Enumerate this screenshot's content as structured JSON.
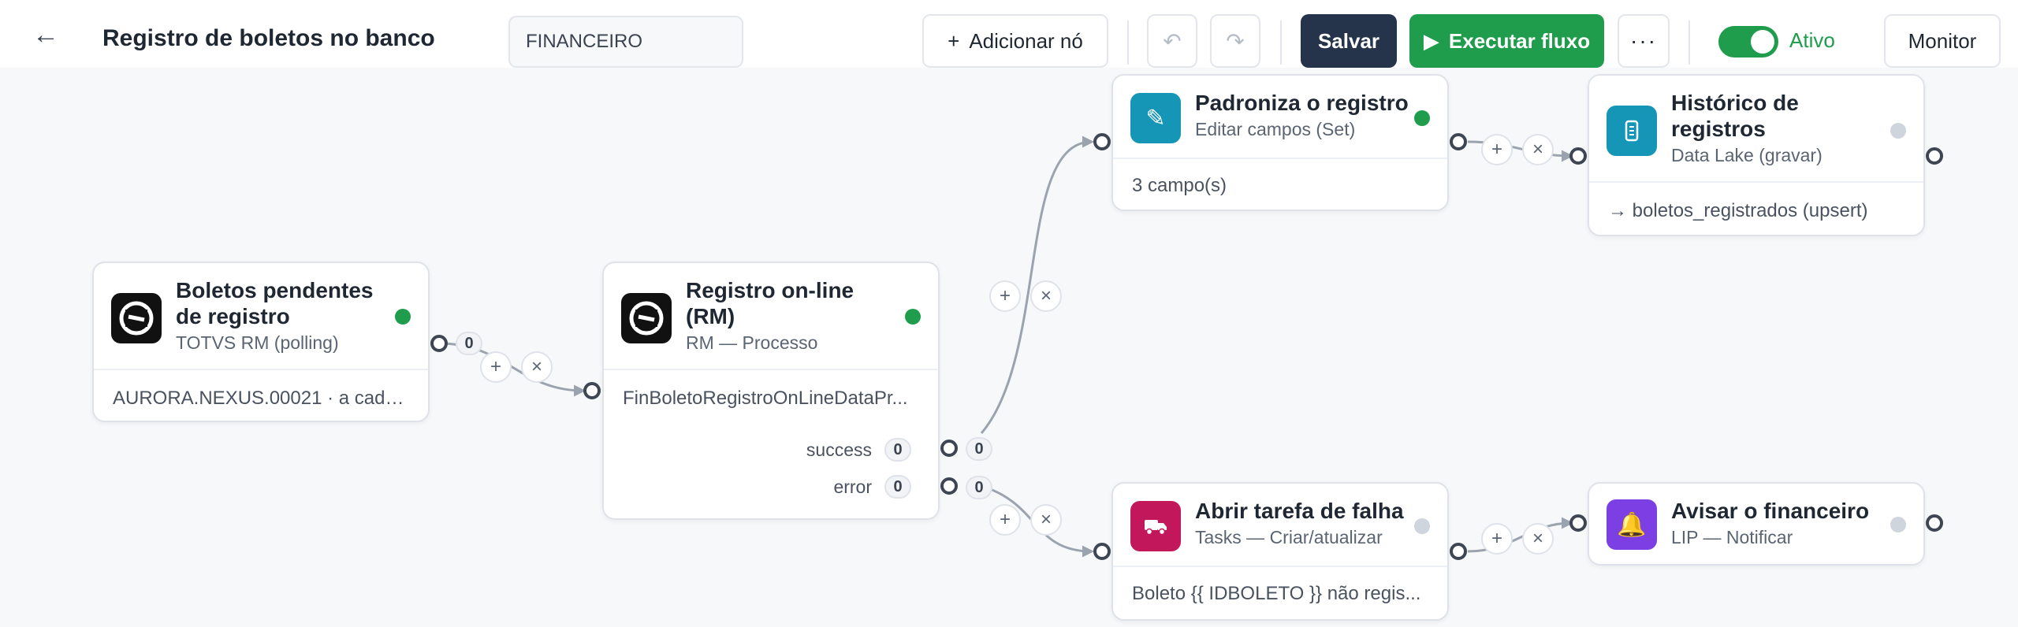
{
  "header": {
    "back_icon": "arrow-left-icon",
    "title": "Registro de boletos no banco",
    "folder_value": "FINANCEIRO",
    "add_node_label": "Adicionar nó",
    "undo_icon": "undo-icon",
    "redo_icon": "redo-icon",
    "save_label": "Salvar",
    "run_label": "Executar fluxo",
    "more_label": "···",
    "active_label": "Ativo",
    "active_on": true,
    "monitor_label": "Monitor"
  },
  "nodes": {
    "boletos_pendentes": {
      "title_line1": "Boletos pendentes",
      "title_line2": "de registro",
      "subtitle": "TOTVS RM (polling)",
      "body": "AURORA.NEXUS.00021 · a cada...",
      "icon": "totvs-logo-icon",
      "status": "active",
      "out_count": "0"
    },
    "registro_online": {
      "title_line1": "Registro on-line",
      "title_line2": "(RM)",
      "subtitle": "RM — Processo",
      "body": "FinBoletoRegistroOnLineDataPr...",
      "icon": "totvs-logo-icon",
      "status": "active",
      "outputs": [
        {
          "label": "success",
          "count": "0",
          "edge_count": "0"
        },
        {
          "label": "error",
          "count": "0",
          "edge_count": "0"
        }
      ]
    },
    "padroniza": {
      "title": "Padroniza o registro",
      "subtitle": "Editar campos (Set)",
      "body": "3 campo(s)",
      "icon": "pencil-icon",
      "status": "active"
    },
    "historico": {
      "title_line1": "Histórico de",
      "title_line2": "registros",
      "subtitle": "Data Lake (gravar)",
      "body": "→ boletos_registrados (upsert)",
      "icon": "database-icon",
      "status": "idle"
    },
    "abrir_tarefa": {
      "title": "Abrir tarefa de falha",
      "subtitle": "Tasks — Criar/atualizar",
      "body": "Boleto {{ IDBOLETO }} não regis...",
      "icon": "truck-icon",
      "status": "idle"
    },
    "avisar": {
      "title": "Avisar o financeiro",
      "subtitle": "LIP — Notificar",
      "icon": "bell-icon",
      "status": "idle"
    }
  },
  "edge_controls": {
    "add_label": "+",
    "remove_label": "×"
  },
  "colors": {
    "accent_green": "#1f9d4c",
    "save_dark": "#25344b",
    "teal_icon": "#1596b6",
    "magenta_icon": "#c2185b",
    "purple_icon": "#7b3fe4",
    "edge_grey": "#9aa3ae"
  }
}
